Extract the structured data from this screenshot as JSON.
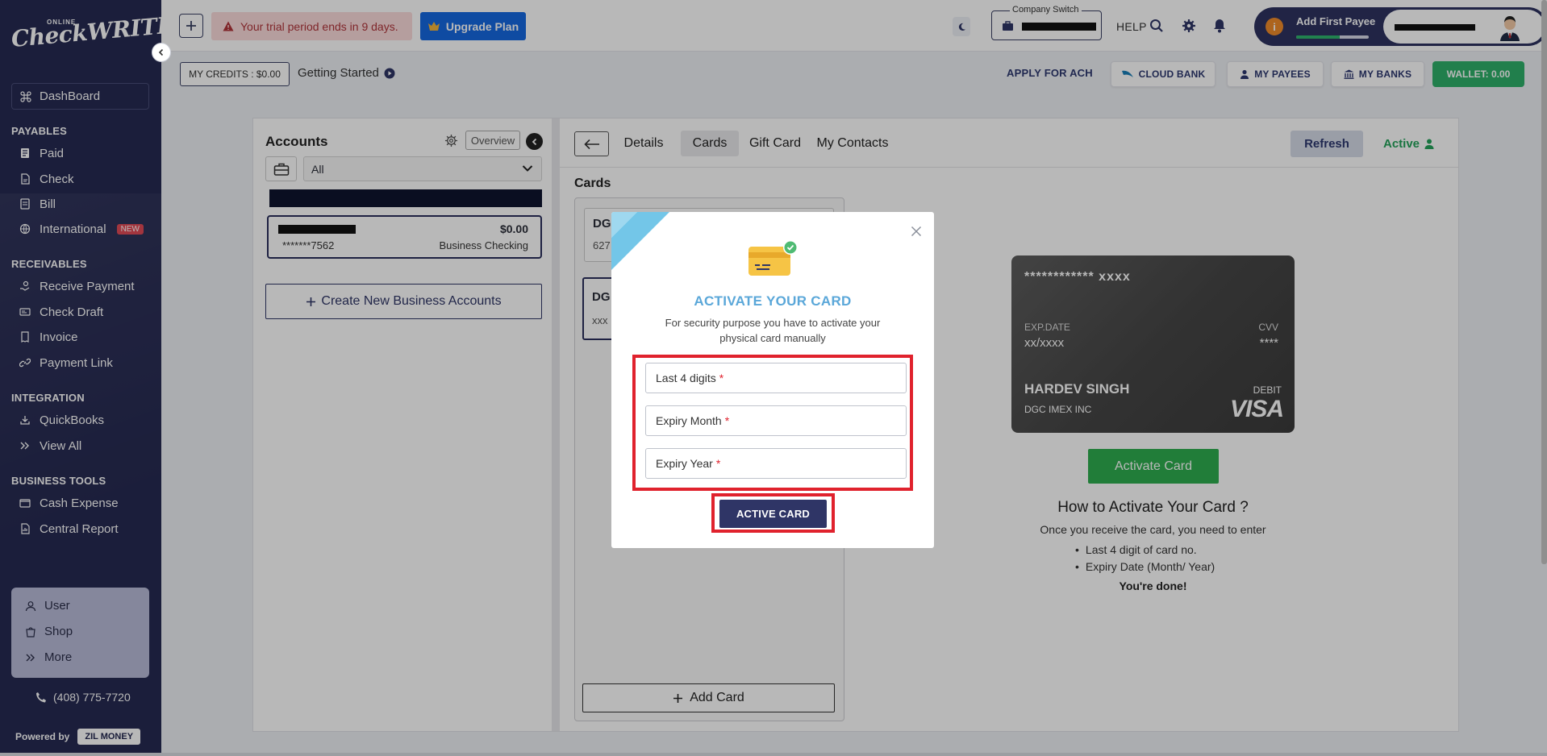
{
  "sidebar": {
    "logo_small": "ONLINE",
    "logo_big": "CheckWRITER",
    "dashboard": "DashBoard",
    "sections": {
      "payables": "PAYABLES",
      "receivables": "RECEIVABLES",
      "integration": "INTEGRATION",
      "business_tools": "BUSINESS TOOLS"
    },
    "payables_items": [
      "Paid",
      "Check",
      "Bill",
      "International"
    ],
    "new_badge": "NEW",
    "receivables_items": [
      "Receive Payment",
      "Check Draft",
      "Invoice",
      "Payment Link"
    ],
    "integration_items": [
      "QuickBooks",
      "View All"
    ],
    "business_tools_items": [
      "Cash Expense",
      "Central Report"
    ],
    "box_items": [
      "User",
      "Shop",
      "More"
    ],
    "phone": "(408) 775-7720",
    "powered_by": "Powered by",
    "zil_money": "ZIL MONEY"
  },
  "header": {
    "trial_text": "Your trial period ends in 9 days.",
    "upgrade_label": "Upgrade Plan",
    "company_switch_label": "Company Switch",
    "help": "HELP",
    "add_first_payee": "Add First Payee",
    "payee_progress": 0.6,
    "info_glyph": "i"
  },
  "subbar": {
    "credits": "MY CREDITS : $0.00",
    "getting_started": "Getting Started",
    "apply_ach": "APPLY FOR ACH",
    "cloud_bank": "CLOUD BANK",
    "my_payees": "MY PAYEES",
    "my_banks": "MY BANKS",
    "wallet": "WALLET: 0.00"
  },
  "accounts": {
    "title": "Accounts",
    "overview": "Overview",
    "filter_value": "All",
    "account": {
      "amount": "$0.00",
      "number": "*******7562",
      "type": "Business Checking"
    },
    "create_label": "Create New Business Accounts"
  },
  "detail": {
    "tabs": [
      "Details",
      "Cards",
      "Gift Card",
      "My Contacts"
    ],
    "active_tab": "Cards",
    "refresh": "Refresh",
    "status": "Active",
    "cards_title": "Cards",
    "card_list": [
      {
        "title": "DG",
        "sub": "627"
      },
      {
        "title": "DG",
        "sub": "xxx"
      }
    ],
    "add_card": "Add Card"
  },
  "virtual_card": {
    "number": "************ xxxx",
    "exp_label": "EXP.DATE",
    "exp_value": "xx/xxxx",
    "cvv_label": "CVV",
    "cvv_value": "****",
    "holder": "HARDEV SINGH",
    "company": "DGC IMEX INC",
    "kind": "DEBIT",
    "network": "VISA"
  },
  "how_to": {
    "activate_button": "Activate Card",
    "title": "How to Activate Your Card ?",
    "desc": "Once you receive the card, you need to enter",
    "steps": [
      "Last 4 digit of card no.",
      "Expiry Date (Month/ Year)"
    ],
    "done": "You're done!"
  },
  "modal": {
    "title": "ACTIVATE YOUR CARD",
    "desc": "For security purpose you have to activate your physical card manually",
    "fields": [
      "Last 4 digits",
      "Expiry Month",
      "Expiry Year"
    ],
    "required_mark": "*",
    "submit": "ACTIVE CARD"
  },
  "colors": {
    "sidebar_bg": "#262a52",
    "primary": "#2f3566",
    "success": "#2eae4f",
    "highlight": "#e0222d",
    "modal_title": "#5aa7d9",
    "upgrade": "#1669e1"
  }
}
